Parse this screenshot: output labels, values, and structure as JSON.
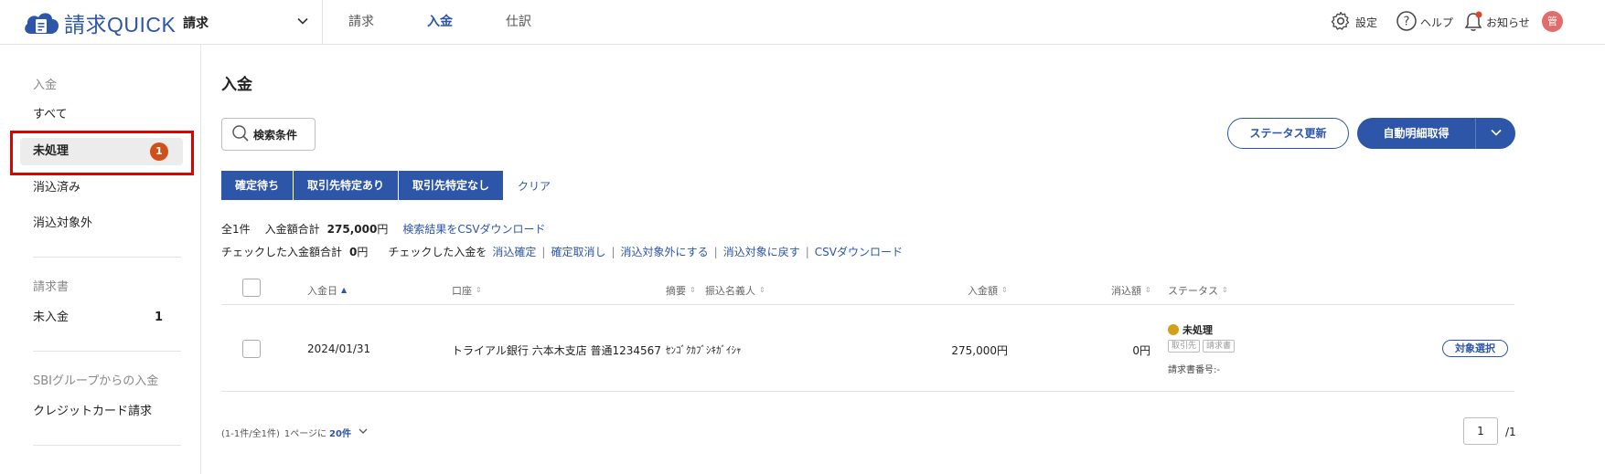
{
  "header": {
    "logo_text": "請求QUICK",
    "app_select": "請求",
    "nav": [
      {
        "label": "請求"
      },
      {
        "label": "入金"
      },
      {
        "label": "仕訳"
      }
    ],
    "settings_label": "設定",
    "help_label": "ヘルプ",
    "notice_label": "お知らせ",
    "avatar_label": "管"
  },
  "sidebar": {
    "section1_title": "入金",
    "section1_items": [
      {
        "label": "すべて"
      },
      {
        "label": "未処理",
        "badge": "1"
      },
      {
        "label": "消込済み"
      },
      {
        "label": "消込対象外"
      }
    ],
    "section2_title": "請求書",
    "section2_items": [
      {
        "label": "未入金",
        "count": "1"
      }
    ],
    "section3_title": "SBIグループからの入金",
    "section3_items": [
      {
        "label": "クレジットカード請求"
      }
    ]
  },
  "main": {
    "title": "入金",
    "search_label": "検索条件",
    "status_update_label": "ステータス更新",
    "auto_fetch_label": "自動明細取得",
    "filters": [
      {
        "label": "確定待ち"
      },
      {
        "label": "取引先特定あり"
      },
      {
        "label": "取引先特定なし"
      }
    ],
    "clear_label": "クリア",
    "summary": {
      "total_count": "全1件",
      "amount_label": "入金額合計",
      "amount_value": "275,000",
      "yen": "円",
      "csv_link": "検索結果をCSVダウンロード",
      "checked_label": "チェックした入金額合計",
      "checked_value": "0",
      "checked_action_label": "チェックした入金を",
      "actions": [
        "消込確定",
        "確定取消し",
        "消込対象外にする",
        "消込対象に戻す",
        "CSVダウンロード"
      ]
    },
    "table": {
      "headers": {
        "date": "入金日",
        "account": "口座",
        "memo": "摘要",
        "payer": "振込名義人",
        "amount": "入金額",
        "cleared": "消込額",
        "status": "ステータス"
      },
      "rows": [
        {
          "date": "2024/01/31",
          "account": "トライアル銀行 六本木支店 普通1234567",
          "payer": "ｾﾝｺﾞｸｶﾌﾞｼｷｶﾞｲｼｬ",
          "amount": "275,000円",
          "cleared": "0円",
          "status": "未処理",
          "tag1": "取引先",
          "tag2": "請求書",
          "invoice_no": "請求書番号:-",
          "action": "対象選択"
        }
      ]
    },
    "pager": {
      "range": "(1-1件/全1件)",
      "per_page_label": "1ページに",
      "per_page_value": "20件",
      "current_page": "1",
      "total_pages": "/1"
    }
  },
  "colors": {
    "accent": "#2d55a8",
    "badge": "#d1501a",
    "status_dot": "#d4a017",
    "highlight": "#e00000"
  }
}
